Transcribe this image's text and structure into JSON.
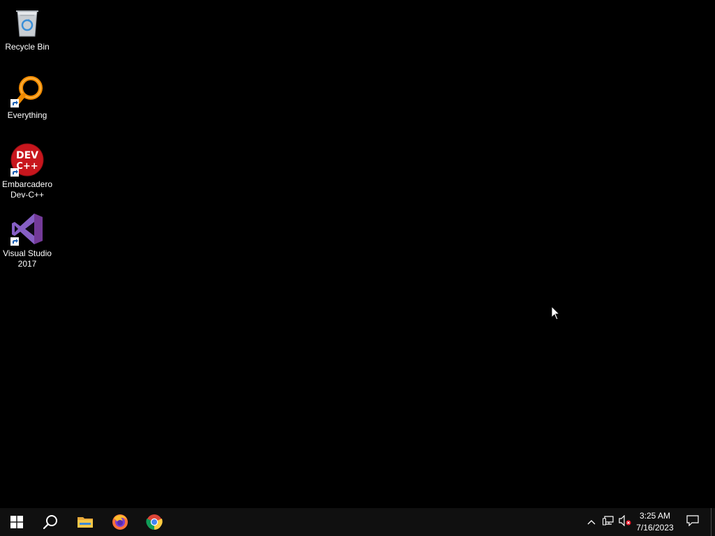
{
  "desktop": {
    "background": "#000000",
    "icons": [
      {
        "label": "Recycle Bin",
        "icon": "recycle-bin-icon",
        "shortcut": false
      },
      {
        "label": "Everything",
        "icon": "everything-search-icon",
        "shortcut": true
      },
      {
        "label": "Embarcadero Dev-C++",
        "icon": "dev-cpp-icon",
        "shortcut": true
      },
      {
        "label": "Visual Studio 2017",
        "icon": "visual-studio-icon",
        "shortcut": true
      }
    ]
  },
  "taskbar": {
    "background": "#101010",
    "pinned": [
      {
        "name": "start",
        "icon": "windows-start-icon"
      },
      {
        "name": "search",
        "icon": "search-icon"
      },
      {
        "name": "file-explorer",
        "icon": "folder-icon"
      },
      {
        "name": "firefox",
        "icon": "firefox-icon"
      },
      {
        "name": "chrome",
        "icon": "chrome-icon"
      }
    ],
    "tray": {
      "icons": [
        "chevron-up-icon",
        "network-icon",
        "volume-muted-icon"
      ],
      "time": "3:25 AM",
      "date": "7/16/2023",
      "notification_icon": "notification-icon"
    }
  }
}
